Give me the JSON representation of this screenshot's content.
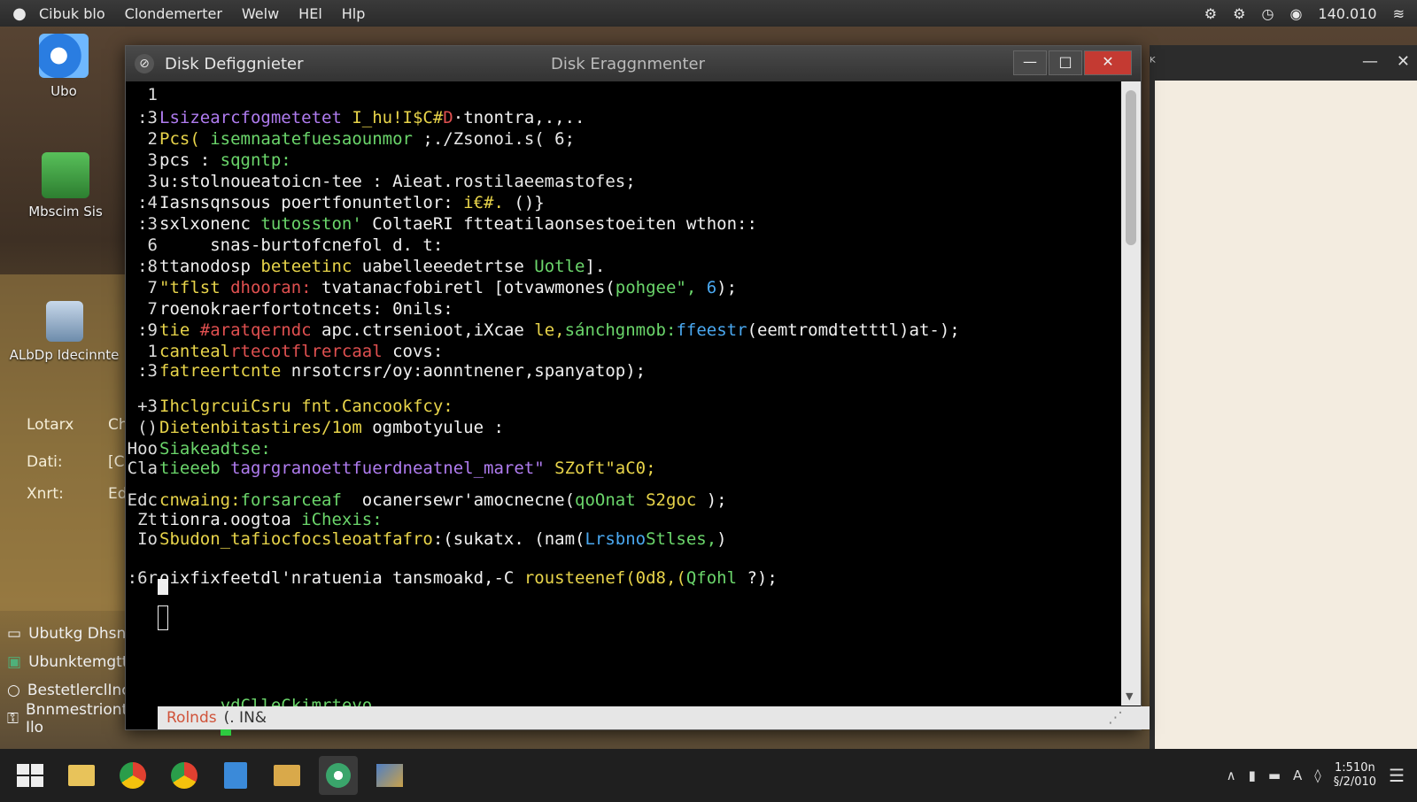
{
  "menubar": {
    "items": [
      "Cibuk blo",
      "Clondemerter",
      "Welw",
      "HEl",
      "Hlp"
    ],
    "tray_text": "140.010"
  },
  "desktop": {
    "icons": [
      {
        "label": "Ubo"
      },
      {
        "label": "Mbscim Sis"
      },
      {
        "label": "ALbDp Idecinnte"
      }
    ],
    "form": [
      {
        "label": "Lotarx",
        "value": "Ch"
      },
      {
        "label": "Dati:",
        "value": "[Cl"
      },
      {
        "label": "Xnrt:",
        "value": "Ed"
      }
    ],
    "list": [
      "Ubutkg Dhsnntc",
      "Ubunktemgttalo",
      "BestetlerclInck",
      "Bnnmestrionte Ilo"
    ]
  },
  "window": {
    "title": "Disk Defiggnieter",
    "title_center": "Disk Eraggnmenter",
    "minimize": "—",
    "maximize": "□",
    "close": "✕"
  },
  "terminal": {
    "lines": [
      {
        "g": "1",
        "segs": []
      },
      {
        "g": ":3",
        "segs": [
          {
            "t": "Lsizearcfogmetetet",
            "c": "#b07cf0"
          },
          {
            "t": " I_hu!I$C#",
            "c": "#e8d44a"
          },
          {
            "t": "D",
            "c": "#e05050"
          },
          {
            "t": "·tnontra,.,..",
            "c": "#f0f0f0"
          }
        ]
      },
      {
        "g": "2",
        "segs": [
          {
            "t": "Pcs(",
            "c": "#e8d44a"
          },
          {
            "t": " isemnaatefuesaounmor",
            "c": "#6bd66b"
          },
          {
            "t": " ;./Zsonoi.s( 6;",
            "c": "#e8e8e8"
          }
        ]
      },
      {
        "g": "3",
        "segs": [
          {
            "t": "pcs : ",
            "c": "#f0f0f0"
          },
          {
            "t": "sqgntp:",
            "c": "#6bd66b"
          }
        ]
      },
      {
        "g": "3",
        "segs": [
          {
            "t": "u:stolnoueatoicn-tee : Aieat.",
            "c": "#f0f0f0"
          },
          {
            "t": "rostilaeemastofes;",
            "c": "#e8e8e8"
          }
        ]
      },
      {
        "g": ":4",
        "segs": [
          {
            "t": "Iasnsqnsous poertfonuntetlor: ",
            "c": "#f0f0f0"
          },
          {
            "t": "i€#.",
            "c": "#e8d44a"
          },
          {
            "t": " ()}",
            "c": "#f0f0f0"
          }
        ]
      },
      {
        "g": ":3",
        "segs": [
          {
            "t": "sxlxonenc ",
            "c": "#f0f0f0"
          },
          {
            "t": "tutosston'",
            "c": "#6bd66b"
          },
          {
            "t": " ColtaeRI ftteatilaonsestoeiten wthon::",
            "c": "#f0f0f0"
          }
        ]
      },
      {
        "g": "6",
        "segs": [
          {
            "t": "     snas-burtofcnefol d. t:",
            "c": "#f0f0f0"
          }
        ]
      },
      {
        "g": ":8",
        "segs": [
          {
            "t": "ttanodosp ",
            "c": "#f0f0f0"
          },
          {
            "t": "beteetinc",
            "c": "#e8d44a"
          },
          {
            "t": " uabelleeedetrtse ",
            "c": "#f0f0f0"
          },
          {
            "t": "Uotle",
            "c": "#6bd66b"
          },
          {
            "t": "].",
            "c": "#f0f0f0"
          }
        ]
      },
      {
        "g": "7",
        "segs": [
          {
            "t": "\"tflst ",
            "c": "#e8d44a"
          },
          {
            "t": "dhooran:",
            "c": "#e05050"
          },
          {
            "t": " tvatanacfobiretl [otvawmones(",
            "c": "#f0f0f0"
          },
          {
            "t": "pohgee\",",
            "c": "#6bd66b"
          },
          {
            "t": " 6",
            "c": "#4aa8f0"
          },
          {
            "t": ");",
            "c": "#f0f0f0"
          }
        ]
      },
      {
        "g": "7",
        "segs": [
          {
            "t": "roenokraerfortotncets: 0nils:",
            "c": "#f0f0f0"
          }
        ]
      },
      {
        "g": ":9",
        "segs": [
          {
            "t": "tie ",
            "c": "#e8d44a"
          },
          {
            "t": "#aratqerndc",
            "c": "#e05050"
          },
          {
            "t": " apc.ctrsenioot,iXcae",
            "c": "#f0f0f0"
          },
          {
            "t": " le,",
            "c": "#e8d44a"
          },
          {
            "t": "sánchgnmob:",
            "c": "#6bd66b"
          },
          {
            "t": "ffeestr",
            "c": "#4aa8f0"
          },
          {
            "t": "(eemtromdtetttl)at-);",
            "c": "#f0f0f0"
          }
        ]
      },
      {
        "g": "1",
        "segs": [
          {
            "t": "canteal",
            "c": "#e8d44a"
          },
          {
            "t": "rtecotflrercaal",
            "c": "#e05050"
          },
          {
            "t": " covs:",
            "c": "#f0f0f0"
          }
        ]
      },
      {
        "g": ":3",
        "segs": [
          {
            "t": "fatreertcnte ",
            "c": "#e8d44a"
          },
          {
            "t": "nrsotcrsr/oy:aonntnener,spanyatop);",
            "c": "#f0f0f0"
          }
        ]
      },
      {
        "g": "",
        "segs": []
      },
      {
        "g": "+3",
        "segs": [
          {
            "t": "IhclgrcuiCsru fnt.Cancookfcy:",
            "c": "#e8d44a"
          }
        ]
      },
      {
        "g": "()",
        "segs": [
          {
            "t": "Dietenbitastires/1om ",
            "c": "#e8d44a"
          },
          {
            "t": "ogmbotyulue :",
            "c": "#f0f0f0"
          }
        ]
      },
      {
        "g": "Hoo",
        "segs": [
          {
            "t": "Siakeadtse:",
            "c": "#6bd66b"
          }
        ]
      },
      {
        "g": "Cla",
        "segs": [
          {
            "t": "tieeeb ",
            "c": "#6bd66b"
          },
          {
            "t": "tagrgranoettfuerdneatnel_maret\"",
            "c": "#b07cf0"
          },
          {
            "t": " SZoft\"aC0;",
            "c": "#e8d44a"
          }
        ]
      },
      {
        "g": "",
        "segs": []
      },
      {
        "g": "Edc",
        "segs": [
          {
            "t": "cnwaing:",
            "c": "#e8d44a"
          },
          {
            "t": "forsarceaf",
            "c": "#6bd66b"
          },
          {
            "t": "  ocanersewr'amocnecne(",
            "c": "#f0f0f0"
          },
          {
            "t": "qoOnat",
            "c": "#6bd66b"
          },
          {
            "t": " S2goc",
            "c": "#e8d44a"
          },
          {
            "t": " );",
            "c": "#f0f0f0"
          }
        ]
      },
      {
        "g": "Zt",
        "segs": [
          {
            "t": "tionra.oogtoa ",
            "c": "#f0f0f0"
          },
          {
            "t": "iChexis:",
            "c": "#6bd66b"
          }
        ]
      },
      {
        "g": "Io",
        "segs": [
          {
            "t": "Sbudon_tafiocfocsleoatfafro",
            "c": "#e8d44a"
          },
          {
            "t": ":(sukatx. (nam(",
            "c": "#f0f0f0"
          },
          {
            "t": "Lrsbno",
            "c": "#4aa8f0"
          },
          {
            "t": "Stlses,",
            "c": "#6bd66b"
          },
          {
            "t": ")",
            "c": "#f0f0f0"
          }
        ]
      },
      {
        "g": "",
        "segs": []
      },
      {
        "g": ":6r",
        "segs": [
          {
            "t": "oixfixfeetdl'nratuenia tansmoakd,-C ",
            "c": "#f0f0f0"
          },
          {
            "t": "rousteenef(0d8,(",
            "c": "#e8d44a"
          },
          {
            "t": "Qfohl",
            "c": "#6bd66b"
          },
          {
            "t": " ?);",
            "c": "#f0f0f0"
          }
        ]
      }
    ],
    "prompt": "ydClleCkimrtevo",
    "status": "Rolnds",
    "status_extra": "(. IN&"
  },
  "taskbar": {
    "clock_time": "1:510n",
    "clock_date": "§/2/010"
  }
}
